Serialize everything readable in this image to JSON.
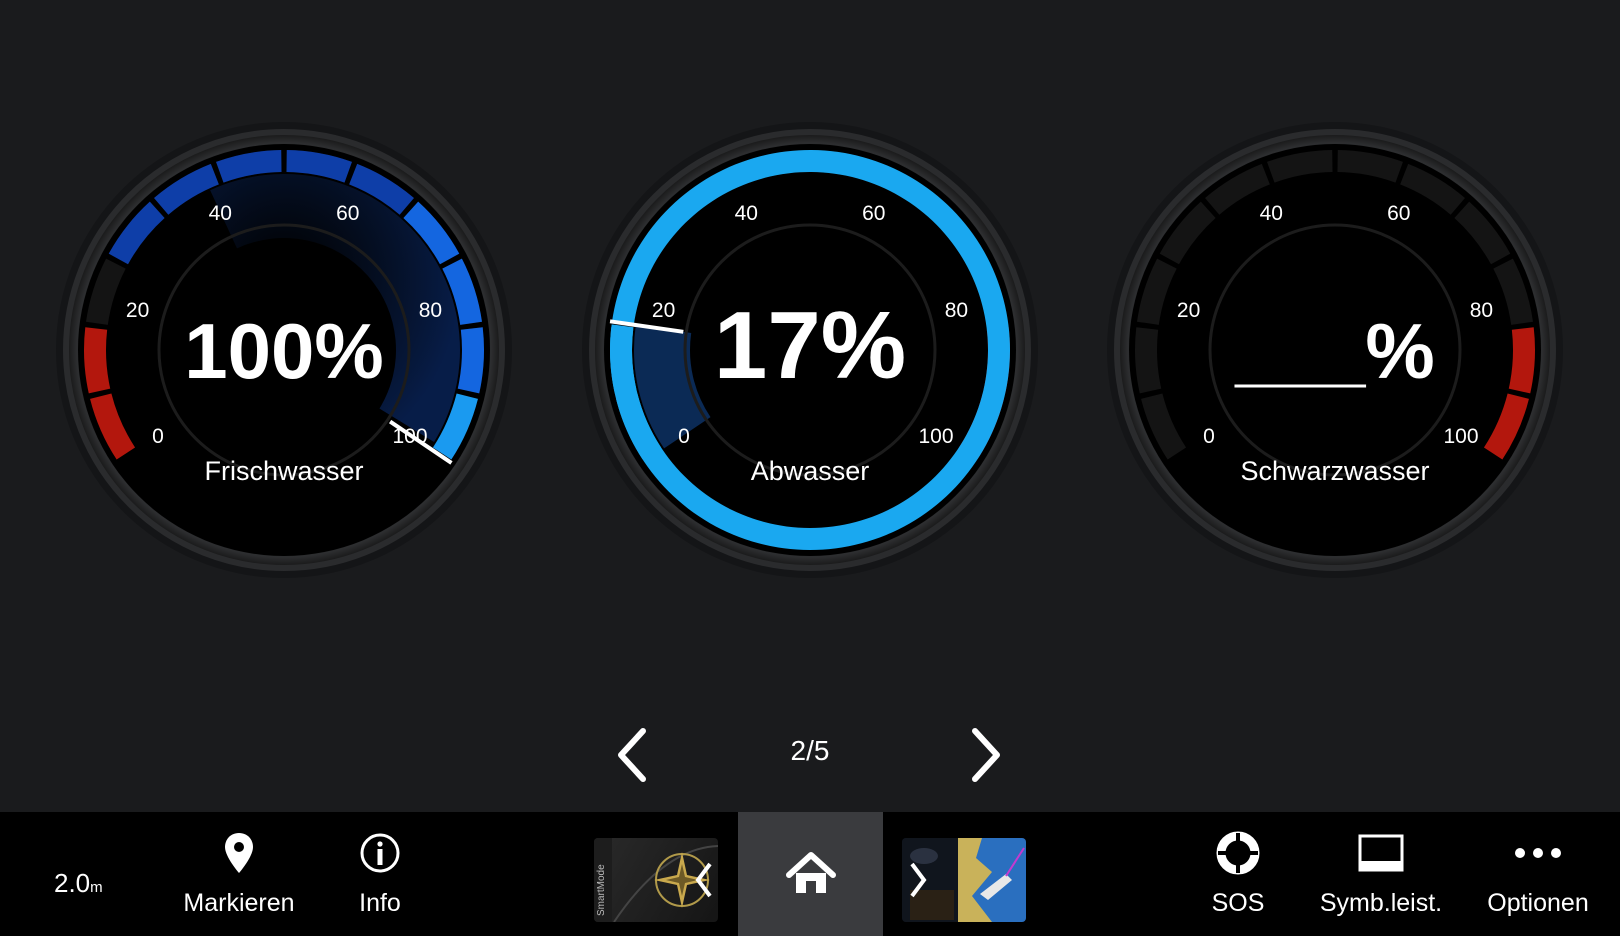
{
  "gauges": [
    {
      "label": "Frischwasser",
      "value_text": "100%",
      "level": 100,
      "fill": "blue-full"
    },
    {
      "label": "Abwasser",
      "value_text": "17%",
      "level": 17,
      "fill": "blue-partial"
    },
    {
      "label": "Schwarzwasser",
      "value_text": "___%",
      "level": null,
      "fill": "none"
    }
  ],
  "gauge_ticks": [
    "0",
    "20",
    "40",
    "60",
    "80",
    "100"
  ],
  "pager": {
    "label": "2/5",
    "prev_icon": "chevron-left-icon",
    "next_icon": "chevron-right-icon"
  },
  "bottombar": {
    "depth_value": "2.0",
    "depth_unit": "m",
    "items": [
      {
        "label": "Markieren",
        "icon": "map-pin-icon"
      },
      {
        "label": "Info",
        "icon": "info-icon"
      },
      {
        "label": "SOS",
        "icon": "lifebuoy-icon"
      },
      {
        "label": "Symb.leist.",
        "icon": "toolbar-icon"
      },
      {
        "label": "Optionen",
        "icon": "more-icon"
      }
    ],
    "smartmode_text": "SmartMode",
    "home_icon": "home-icon"
  },
  "colors": {
    "background": "#1a1b1d",
    "bar": "#000000",
    "red": "#b3170d",
    "blue": "#1466e0",
    "cyan": "#1aa8f0"
  }
}
